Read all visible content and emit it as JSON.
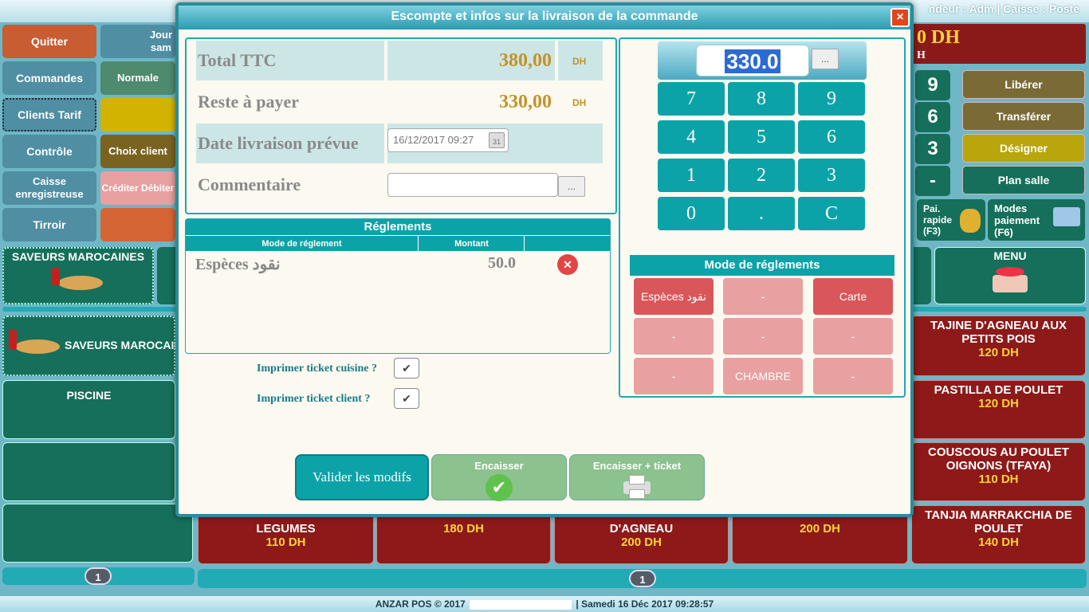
{
  "topbar": {
    "user_text": "ndeur : Adm | Caisse : Poste"
  },
  "big_total": {
    "text": "0 DH",
    "sub": "H"
  },
  "left_buttons": {
    "quit": "Quitter",
    "journee": "Jour\nsam",
    "commands": "Commandes",
    "normale": "Normale",
    "clients_tarif": "Clients Tarif",
    "controle": "Contrôle",
    "choix_client": "Choix client",
    "caisse": "Caisse enregistreuse",
    "crediter": "Créditer Débiter",
    "tiroir": "Tirroir"
  },
  "categories": [
    {
      "label": "SAVEURS MAROCAINES"
    },
    {
      "label": "SAVEURS MAROCAIN"
    },
    {
      "label": "PISCINE"
    },
    {
      "label": "MENU"
    }
  ],
  "right_buttons": {
    "liberer": "Libérer",
    "transferer": "Transférer",
    "designer": "Désigner",
    "plan_salle": "Plan salle",
    "pai_rapide": "Pai. rapide (F3)",
    "modes_paiement": "Modes paiement (F6)",
    "digit9": "9",
    "digit6": "6",
    "digit3": "3",
    "digitminus": "-"
  },
  "products_right": [
    {
      "name": "TAJINE D'AGNEAU AUX PETITS POIS",
      "price": "120 DH"
    },
    {
      "name": "PASTILLA DE POULET",
      "price": "120 DH"
    },
    {
      "name": "COUSCOUS AU POULET OIGNONS (TFAYA)",
      "price": "110 DH"
    },
    {
      "name": "TANJIA MARRAKCHIA DE POULET",
      "price": "140 DH"
    }
  ],
  "products_bottom": [
    {
      "name": "LEGUMES",
      "price": "110 DH"
    },
    {
      "name": "",
      "price": "180 DH"
    },
    {
      "name": "D'AGNEAU",
      "price": "200 DH"
    },
    {
      "name": "",
      "price": "200 DH"
    }
  ],
  "pagers": {
    "left": "1",
    "right": "1"
  },
  "footer": {
    "left": "ANZAR POS © 2017",
    "right": "| Samedi 16 Déc 2017 09:28:57"
  },
  "modal": {
    "title": "Escompte et infos sur la livraison de la commande",
    "close": "×",
    "total_label": "Total TTC",
    "total_value": "380,00",
    "total_unit": "DH",
    "reste_label": "Reste à payer",
    "reste_value": "330,00",
    "reste_unit": "DH",
    "date_label": "Date livraison prévue",
    "date_value": "16/12/2017 09:27",
    "calendar_day": "31",
    "comment_label": "Commentaire",
    "comment_value": "",
    "dots": "...",
    "reglements_title": "Réglements",
    "col_mode": "Mode de réglement",
    "col_montant": "Montant",
    "payment_rows": [
      {
        "mode": "Espèces نقود",
        "amount": "50.0"
      }
    ],
    "print_kitchen": "Imprimer ticket cuisine ?",
    "print_client": "Imprimer ticket client ?",
    "check_mark": "✔",
    "valider": "Valider les modifs",
    "encaisser": "Encaisser",
    "encaisser_ticket": "Encaisser + ticket",
    "amount_display": "330.0",
    "keys": [
      "7",
      "8",
      "9",
      "4",
      "5",
      "6",
      "1",
      "2",
      "3",
      "0",
      ".",
      "C"
    ],
    "mode_title": "Mode de réglements",
    "modes": [
      "Espèces نقود",
      "-",
      "Carte",
      "-",
      "-",
      "-",
      "-",
      "CHAMBRE",
      "-"
    ]
  }
}
